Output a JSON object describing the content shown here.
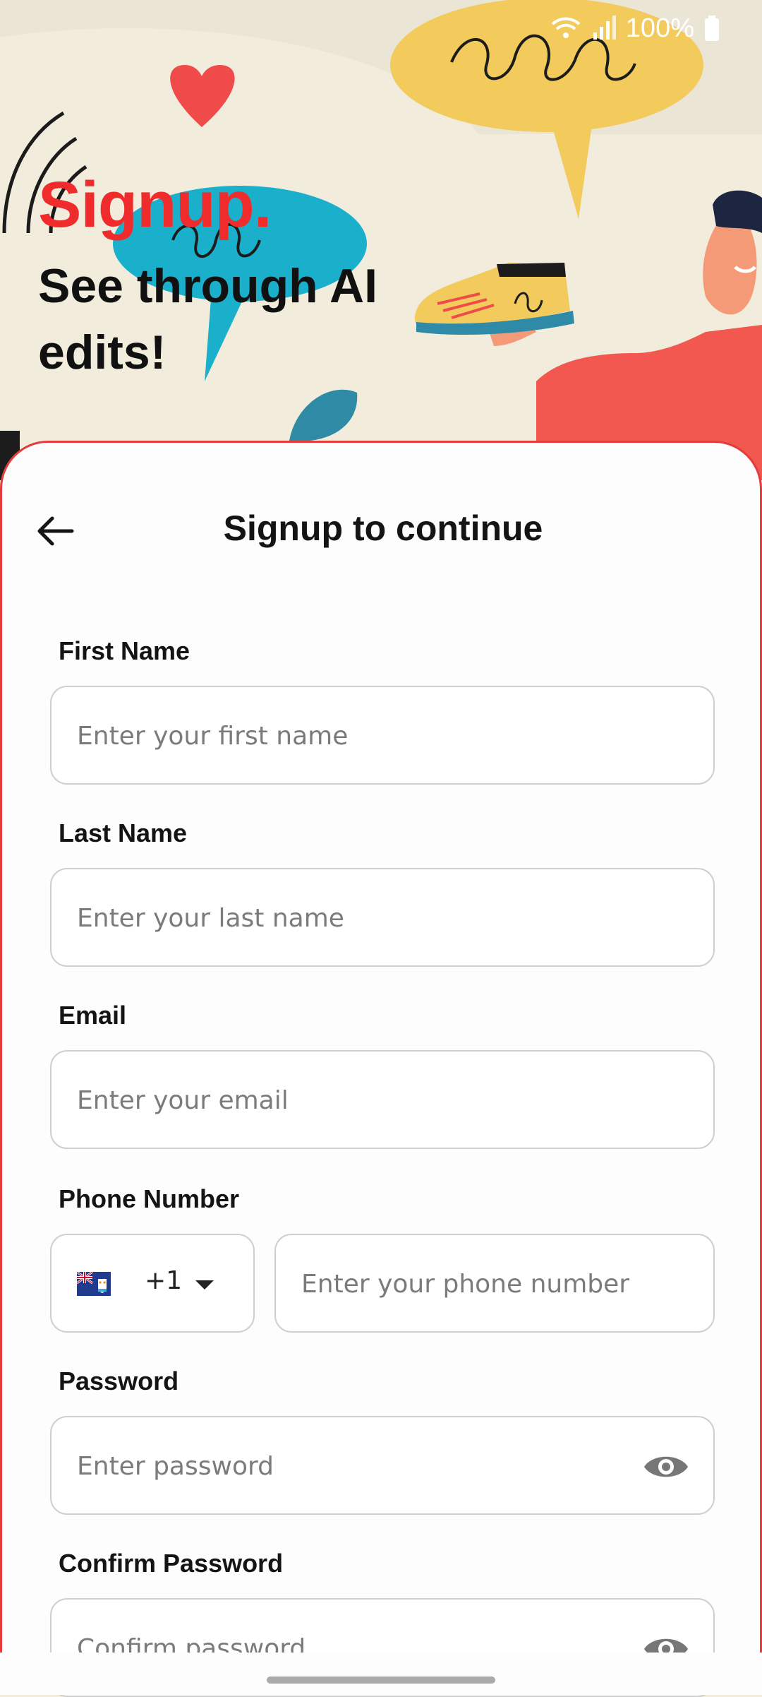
{
  "status_bar": {
    "battery": "100%"
  },
  "hero": {
    "title": "Signup.",
    "subtitle": "See through AI edits!"
  },
  "card": {
    "title": "Signup to continue",
    "back_icon": "arrow-left-icon"
  },
  "form": {
    "first_name": {
      "label": "First Name",
      "placeholder": "Enter your first name",
      "value": ""
    },
    "last_name": {
      "label": "Last Name",
      "placeholder": "Enter your last name",
      "value": ""
    },
    "email": {
      "label": "Email",
      "placeholder": "Enter your email",
      "value": ""
    },
    "phone": {
      "label": "Phone Number",
      "country_code": "+1",
      "country_flag_icon": "anguilla-flag-icon",
      "placeholder": "Enter your phone number",
      "value": ""
    },
    "password": {
      "label": "Password",
      "placeholder": "Enter password",
      "value": "",
      "toggle_icon": "eye-icon"
    },
    "confirm_password": {
      "label": "Confirm Password",
      "placeholder": "Confirm password",
      "value": "",
      "toggle_icon": "eye-icon"
    }
  },
  "colors": {
    "accent_red": "#ef2b2b",
    "card_border": "#e43c3c",
    "hero_bg": "#f1ecdc"
  }
}
